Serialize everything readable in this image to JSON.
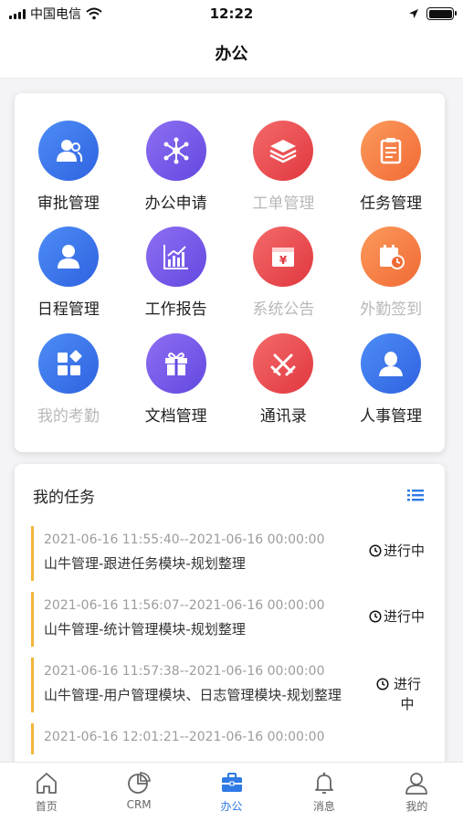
{
  "status_bar": {
    "carrier": "中国电信",
    "time": "12:22"
  },
  "header": {
    "title": "办公"
  },
  "apps": [
    {
      "label": "审批管理",
      "icon": "approval-person-icon",
      "color": "#3f7bee",
      "enabled": true
    },
    {
      "label": "办公申请",
      "icon": "network-nodes-icon",
      "color": "#7557ea",
      "enabled": true
    },
    {
      "label": "工单管理",
      "icon": "layers-stack-icon",
      "color": "#ea4d52",
      "enabled": false
    },
    {
      "label": "任务管理",
      "icon": "clipboard-icon",
      "color": "#f5804a",
      "enabled": true
    },
    {
      "label": "日程管理",
      "icon": "user-icon",
      "color": "#3f7bee",
      "enabled": true
    },
    {
      "label": "工作报告",
      "icon": "bar-chart-icon",
      "color": "#7557ea",
      "enabled": true
    },
    {
      "label": "系统公告",
      "icon": "yen-card-icon",
      "color": "#ea4d52",
      "enabled": false
    },
    {
      "label": "外勤签到",
      "icon": "calendar-clock-icon",
      "color": "#f5804a",
      "enabled": false
    },
    {
      "label": "我的考勤",
      "icon": "grid-blocks-icon",
      "color": "#3f7bee",
      "enabled": false
    },
    {
      "label": "文档管理",
      "icon": "gift-box-icon",
      "color": "#7557ea",
      "enabled": true
    },
    {
      "label": "通讯录",
      "icon": "crossed-swords-icon",
      "color": "#ea4d52",
      "enabled": true
    },
    {
      "label": "人事管理",
      "icon": "person-silhouette-icon",
      "color": "#3f7bee",
      "enabled": true
    }
  ],
  "tasks": {
    "title": "我的任务",
    "items": [
      {
        "time": "2021-06-16 11:55:40--2021-06-16 00:00:00",
        "name": "山牛管理-跟进任务模块-规划整理",
        "status": "进行中"
      },
      {
        "time": "2021-06-16 11:56:07--2021-06-16 00:00:00",
        "name": "山牛管理-统计管理模块-规划整理",
        "status": "进行中"
      },
      {
        "time": "2021-06-16 11:57:38--2021-06-16 00:00:00",
        "name": "山牛管理-用户管理模块、日志管理模块-规划整理",
        "status": "进行中"
      },
      {
        "time": "2021-06-16 12:01:21--2021-06-16 00:00:00",
        "name": "",
        "status": ""
      }
    ]
  },
  "tabs": [
    {
      "label": "首页",
      "icon": "home-icon"
    },
    {
      "label": "CRM",
      "icon": "pie-chart-icon"
    },
    {
      "label": "办公",
      "icon": "briefcase-icon"
    },
    {
      "label": "消息",
      "icon": "bell-icon"
    },
    {
      "label": "我的",
      "icon": "profile-icon"
    }
  ],
  "colors": {
    "accent": "#2f7ae5",
    "task_bar": "#f3b63a"
  }
}
